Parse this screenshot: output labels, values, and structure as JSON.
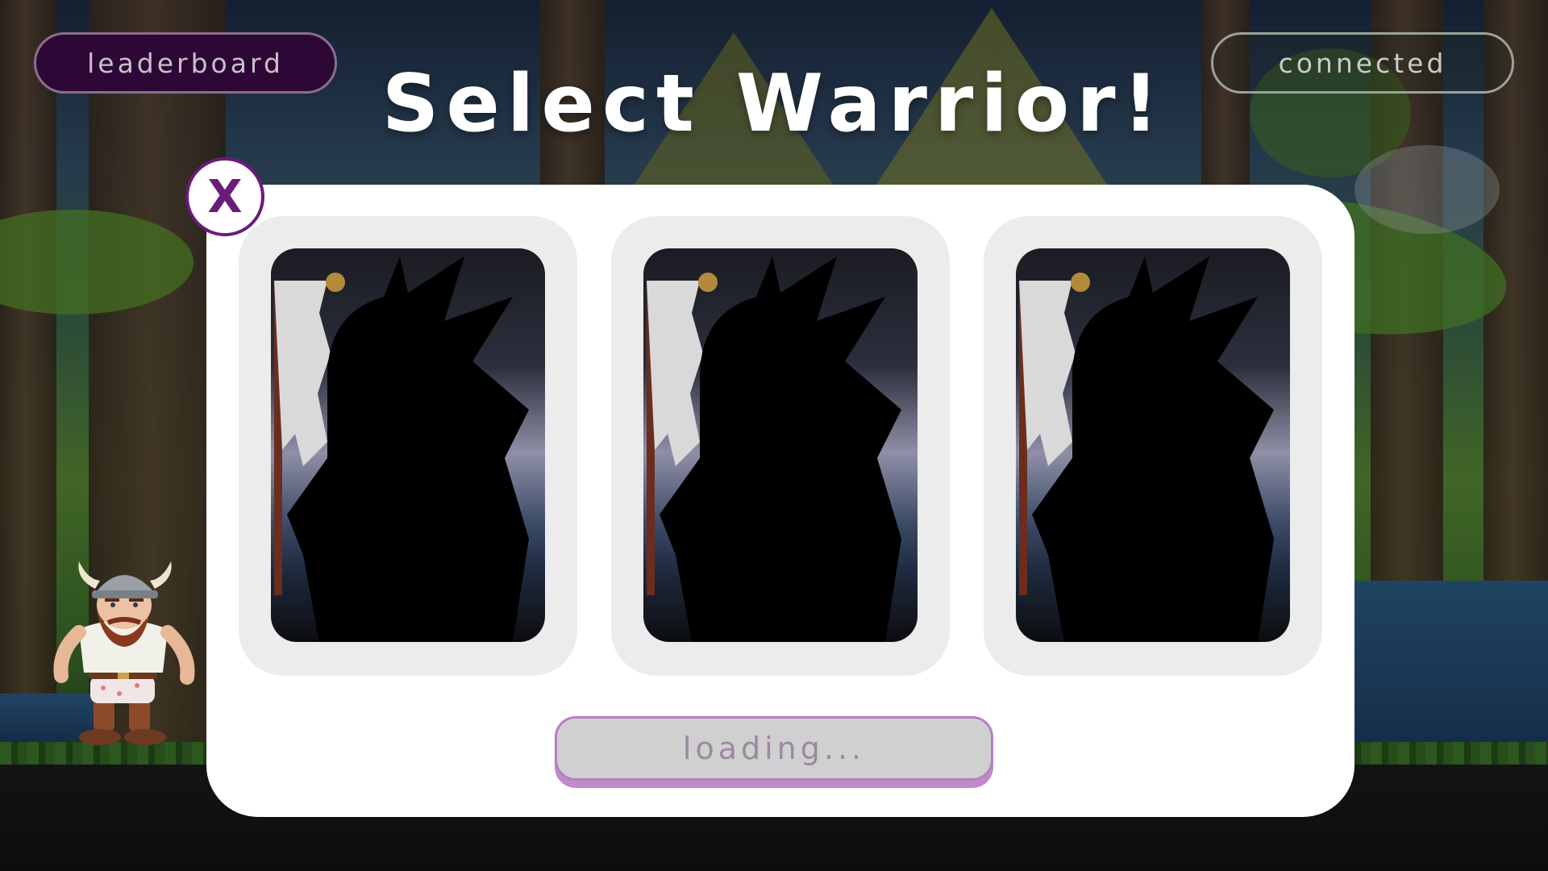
{
  "header": {
    "title": "Select Warrior!",
    "leaderboard_label": "leaderboard",
    "connection_label": "connected"
  },
  "modal": {
    "close_label": "X",
    "cards": [
      {
        "state": "locked-silhouette"
      },
      {
        "state": "locked-silhouette"
      },
      {
        "state": "locked-silhouette"
      }
    ],
    "loading_label": "loading..."
  },
  "colors": {
    "accent_purple": "#6b1b7a",
    "leaderboard_bg": "#2d0736",
    "loading_border": "#b67fc0",
    "modal_bg": "#ffffff",
    "slot_bg": "#ececec"
  },
  "icons": {
    "close": "close-icon",
    "player_character": "viking-warrior"
  }
}
